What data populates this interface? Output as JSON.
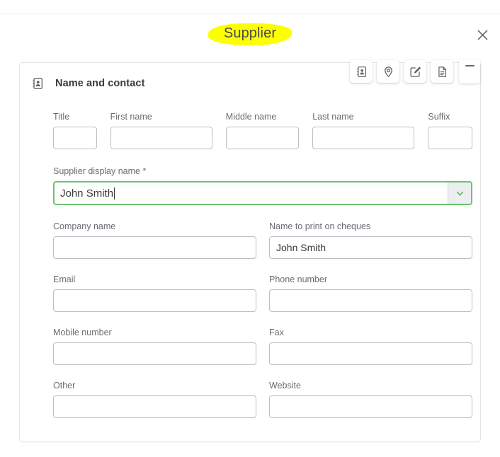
{
  "window": {
    "title": "Supplier",
    "title_highlight_color": "#fcff00",
    "close_icon": "close-icon"
  },
  "toolbar": {
    "buttons": [
      {
        "name": "address-book-icon",
        "label": "Name and contact"
      },
      {
        "name": "location-pin-icon",
        "label": "Addresses"
      },
      {
        "name": "edit-square-icon",
        "label": "Notes"
      },
      {
        "name": "document-icon",
        "label": "Payments"
      }
    ],
    "minimize_label": "Minimize"
  },
  "card": {
    "header": {
      "icon": "address-book-icon",
      "title": "Name and contact"
    },
    "name_row": [
      {
        "label": "Title",
        "value": "",
        "placeholder": ""
      },
      {
        "label": "First name",
        "value": "",
        "placeholder": ""
      },
      {
        "label": "Middle name",
        "value": "",
        "placeholder": ""
      },
      {
        "label": "Last name",
        "value": "",
        "placeholder": ""
      },
      {
        "label": "Suffix",
        "value": "",
        "placeholder": ""
      }
    ],
    "display_name": {
      "label": "Supplier display name *",
      "value": "John Smith",
      "placeholder": "",
      "focus_color": "#6cc46c",
      "dropdown_icon": "chevron-down-icon"
    },
    "rows": [
      {
        "left": {
          "label": "Company name",
          "value": "",
          "placeholder": ""
        },
        "right": {
          "label": "Name to print on cheques",
          "value": "John Smith",
          "placeholder": ""
        }
      },
      {
        "left": {
          "label": "Email",
          "value": "",
          "placeholder": ""
        },
        "right": {
          "label": "Phone number",
          "value": "",
          "placeholder": ""
        }
      },
      {
        "left": {
          "label": "Mobile number",
          "value": "",
          "placeholder": ""
        },
        "right": {
          "label": "Fax",
          "value": "",
          "placeholder": ""
        }
      },
      {
        "left": {
          "label": "Other",
          "value": "",
          "placeholder": ""
        },
        "right": {
          "label": "Website",
          "value": "",
          "placeholder": ""
        }
      }
    ]
  }
}
